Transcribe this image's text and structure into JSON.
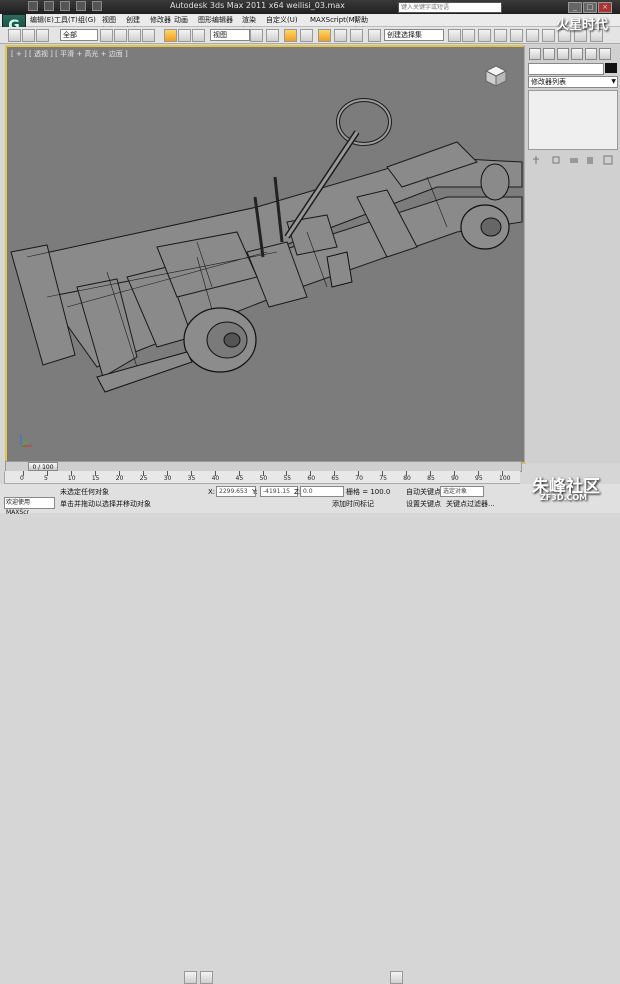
{
  "titlebar": {
    "title": "Autodesk 3ds Max  2011 x64    weilisi_03.max",
    "search_placeholder": "键入关键字或短语",
    "minimize": "_",
    "maximize": "□",
    "close": "×"
  },
  "menu": [
    "编辑(E)",
    "工具(T)",
    "组(G)",
    "视图(V)",
    "创建(C)",
    "修改器",
    "动画",
    "图形编辑器",
    "渲染(R)",
    "自定义(U)",
    "MAXScript(M)",
    "帮助(H)"
  ],
  "toolbar": {
    "selection_filter": "全部",
    "ref_coord": "视图",
    "named_selection": "创建选择集"
  },
  "viewport": {
    "label": "[ + ] [ 透视 ] [ 平滑 + 高光 + 边面 ]"
  },
  "command_panel": {
    "modifier_list": "修改器列表"
  },
  "timeline": {
    "frame_counter": "0 / 100",
    "ruler_labels": [
      "0",
      "5",
      "10",
      "15",
      "20",
      "25",
      "30",
      "35",
      "40",
      "45",
      "50",
      "55",
      "60",
      "65",
      "70",
      "75",
      "80",
      "85",
      "90",
      "95",
      "100"
    ]
  },
  "status": {
    "maxscript_prompt": "欢迎使用 MAXScr",
    "selection_status": "未选定任何对象",
    "prompt": "单击并拖动以选择并移动对象",
    "x_label": "X:",
    "x_value": "2299.653",
    "y_label": "Y:",
    "y_value": "-4191.15",
    "z_label": "Z:",
    "z_value": "0.0",
    "grid": "栅格 = 100.0",
    "add_time_tag": "添加时间标记",
    "auto_key": "自动关键点",
    "set_key": "设置关键点",
    "key_mode_combo": "选定对象",
    "key_filters": "关键点过滤器..."
  },
  "watermarks": {
    "top_right": "火星时代",
    "bottom_right": "朱峰社区",
    "bottom_right_url": "ZF3D.COM"
  },
  "colors": {
    "viewport_bg": "#7c7c7c",
    "active_border": "#e3c34b",
    "title_bg": "#2a2a2a"
  }
}
